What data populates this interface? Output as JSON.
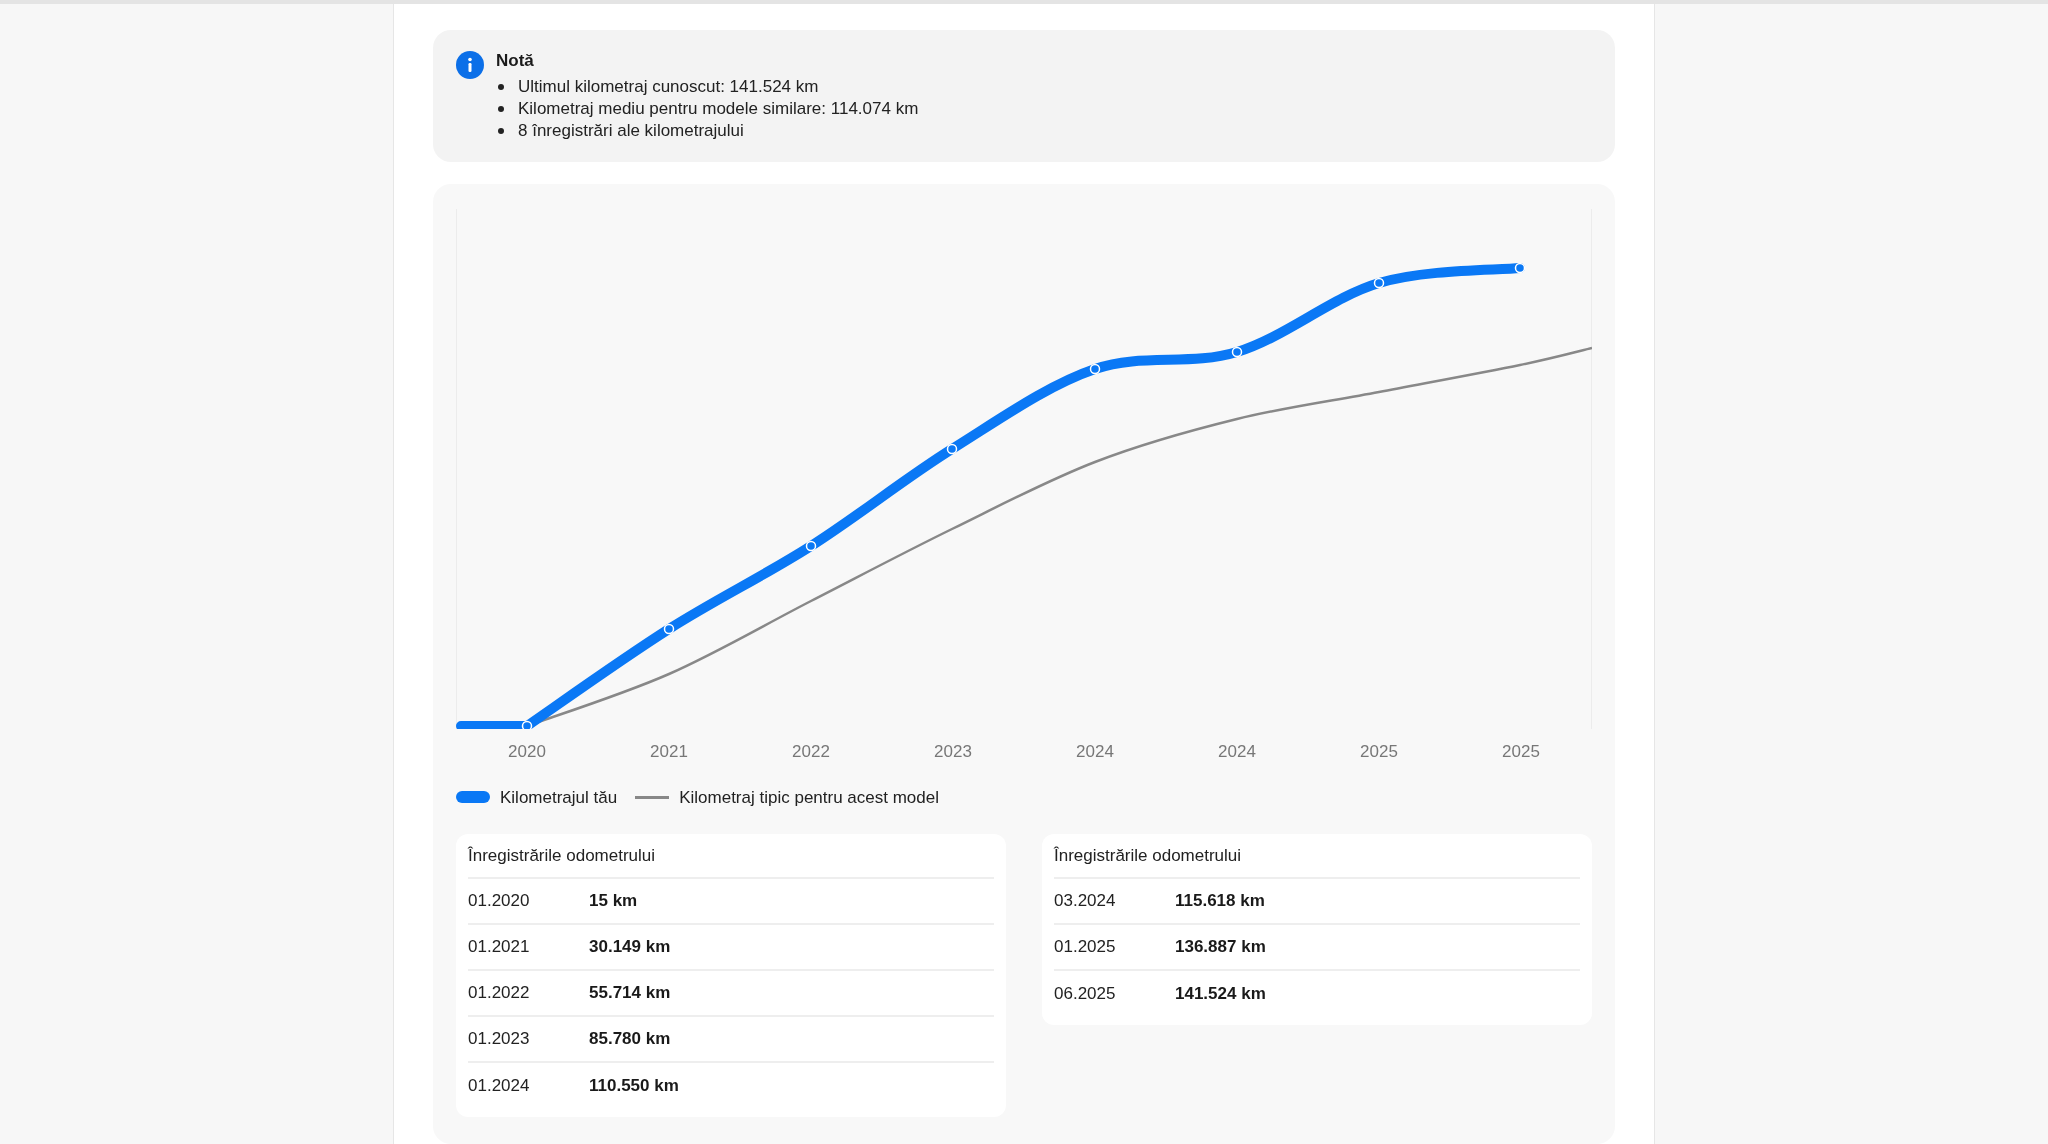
{
  "note": {
    "title": "Notă",
    "items": [
      "Ultimul kilometraj cunoscut: 141.524 km",
      "Kilometraj mediu pentru modele similare: 114.074 km",
      "8 înregistrări ale kilometrajului"
    ]
  },
  "chart": {
    "x_labels": [
      "2020",
      "2021",
      "2022",
      "2023",
      "2024",
      "2024",
      "2025",
      "2025"
    ],
    "legend": [
      {
        "label": "Kilometrajul tău",
        "kind": "thick"
      },
      {
        "label": "Kilometraj tipic pentru acest model",
        "kind": "thin"
      }
    ]
  },
  "tables": [
    {
      "title": "Înregistrările odometrului",
      "rows": [
        {
          "date": "01.2020",
          "km": "15 km"
        },
        {
          "date": "01.2021",
          "km": "30.149 km"
        },
        {
          "date": "01.2022",
          "km": "55.714 km"
        },
        {
          "date": "01.2023",
          "km": "85.780 km"
        },
        {
          "date": "01.2024",
          "km": "110.550 km"
        }
      ]
    },
    {
      "title": "Înregistrările odometrului",
      "rows": [
        {
          "date": "03.2024",
          "km": "115.618 km"
        },
        {
          "date": "01.2025",
          "km": "136.887 km"
        },
        {
          "date": "06.2025",
          "km": "141.524 km"
        }
      ]
    }
  ]
}
